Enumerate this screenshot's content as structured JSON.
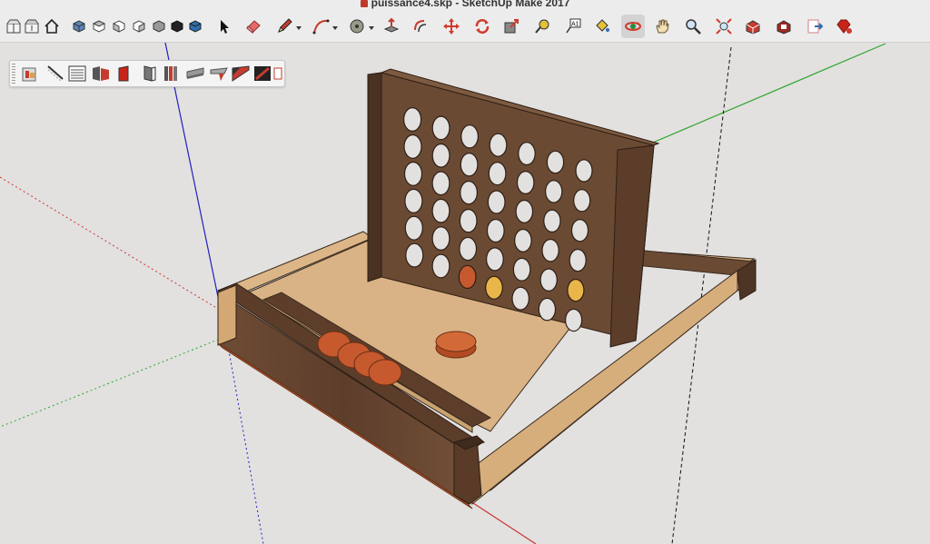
{
  "window": {
    "title": "puissance4.skp - SketchUp Make 2017"
  },
  "toolbar": {
    "tools": [
      {
        "name": "get-models-icon",
        "has_menu": false
      },
      {
        "name": "share-model-icon",
        "has_menu": false
      },
      {
        "name": "home-icon",
        "has_menu": false
      },
      {
        "name": "iso-view-icon",
        "has_menu": false
      },
      {
        "name": "top-view-icon",
        "has_menu": false
      },
      {
        "name": "front-view-icon",
        "has_menu": false
      },
      {
        "name": "right-view-icon",
        "has_menu": false
      },
      {
        "name": "back-view-icon",
        "has_menu": false
      },
      {
        "name": "left-view-icon",
        "has_menu": false
      },
      {
        "name": "bottom-view-icon",
        "has_menu": false
      },
      {
        "name": "select-icon",
        "has_menu": false
      },
      {
        "name": "eraser-icon",
        "has_menu": false
      },
      {
        "name": "pencil-icon",
        "has_menu": true
      },
      {
        "name": "arc-icon",
        "has_menu": true
      },
      {
        "name": "shapes-icon",
        "has_menu": true
      },
      {
        "name": "push-pull-icon",
        "has_menu": false
      },
      {
        "name": "offset-icon",
        "has_menu": false
      },
      {
        "name": "move-icon",
        "has_menu": false
      },
      {
        "name": "rotate-icon",
        "has_menu": false
      },
      {
        "name": "scale-icon",
        "has_menu": false
      },
      {
        "name": "tape-measure-icon",
        "has_menu": false
      },
      {
        "name": "text-icon",
        "has_menu": false
      },
      {
        "name": "paint-bucket-icon",
        "has_menu": false
      },
      {
        "name": "orbit-icon",
        "has_menu": false
      },
      {
        "name": "pan-icon",
        "has_menu": false
      },
      {
        "name": "zoom-icon",
        "has_menu": false
      },
      {
        "name": "zoom-extents-icon",
        "has_menu": false
      },
      {
        "name": "warehouse-icon",
        "has_menu": false
      },
      {
        "name": "extension-warehouse-icon",
        "has_menu": false
      },
      {
        "name": "layout-send-icon",
        "has_menu": false
      },
      {
        "name": "ruby-console-icon",
        "has_menu": false
      }
    ],
    "text_tool_glyph": "A1",
    "selected_tool": "orbit-icon"
  },
  "styles_palette": {
    "buttons": [
      "xray-icon",
      "back-edges-icon",
      "wireframe-icon",
      "hidden-line-icon",
      "shaded-icon",
      "shaded-textures-icon",
      "monochrome-icon",
      "edge-style-icon",
      "profiles-icon",
      "depth-cue-icon",
      "extension-icon",
      "endpoints-icon"
    ]
  },
  "scene": {
    "model": "connect-four-board",
    "grid_columns": 7,
    "grid_rows": 6,
    "colors": {
      "background": "#e2e1df",
      "dark_wood": "#6b4a34",
      "light_wood": "#d7b082",
      "axis_red": "#cc3333",
      "axis_green": "#2fa52f",
      "axis_blue": "#2020c0",
      "token_red": "#c65a2e",
      "token_yellow": "#e9b64a"
    }
  }
}
